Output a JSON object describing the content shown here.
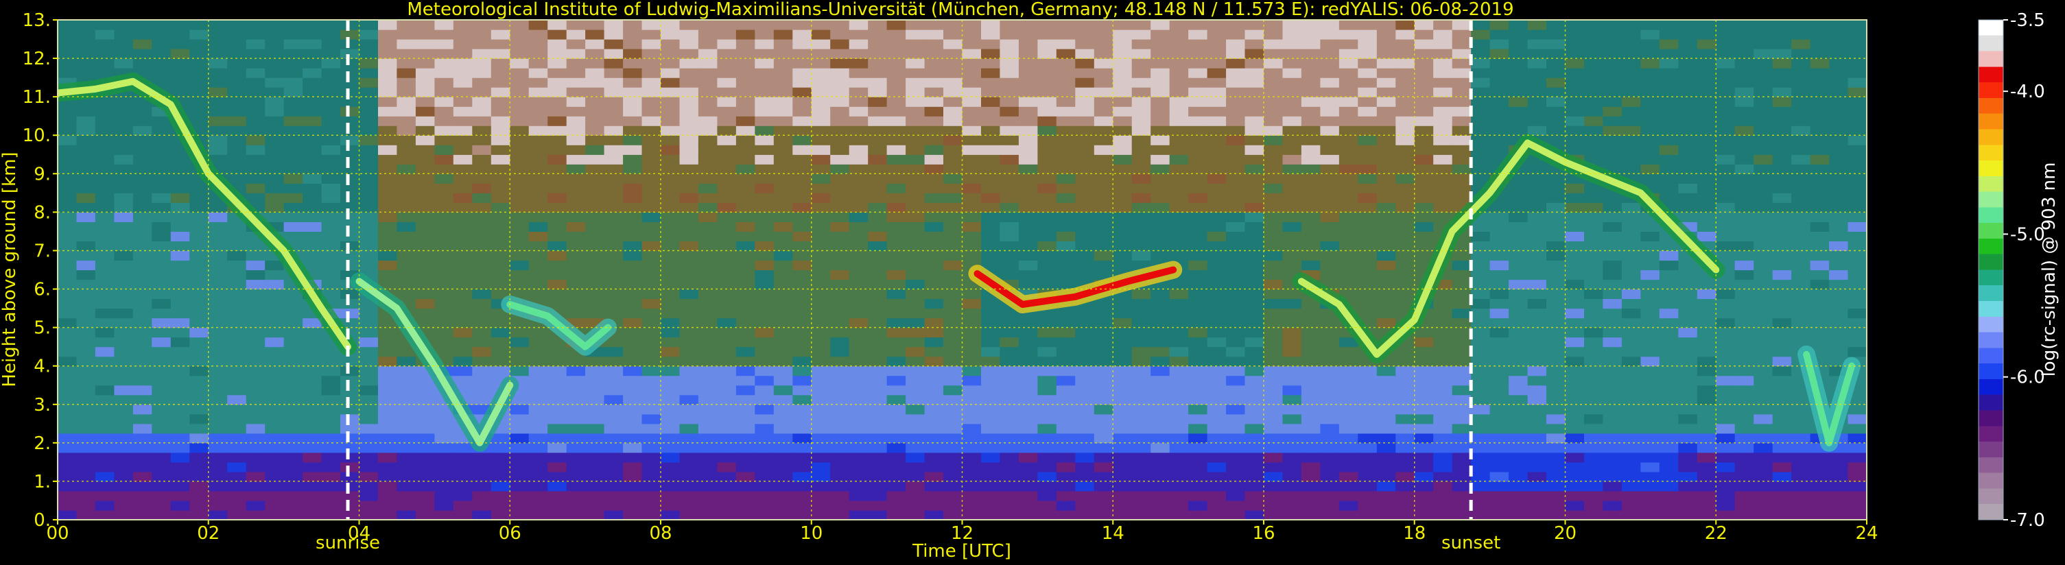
{
  "chart_data": {
    "type": "heatmap",
    "title": "Meteorological Institute of Ludwig-Maximilians-Universität (München, Germany; 48.148 N / 11.573 E):    redYALIS: 06-08-2019",
    "xlabel": "Time [UTC]",
    "ylabel": "Height above ground [km]",
    "xlim": [
      0,
      24
    ],
    "ylim": [
      0,
      13
    ],
    "x_ticks": [
      0,
      2,
      4,
      6,
      8,
      10,
      12,
      14,
      16,
      18,
      20,
      22,
      24
    ],
    "x_tick_labels": [
      "00",
      "02",
      "04",
      "06",
      "08",
      "10",
      "12",
      "14",
      "16",
      "18",
      "20",
      "22",
      "24"
    ],
    "y_ticks": [
      0,
      1,
      2,
      3,
      4,
      5,
      6,
      7,
      8,
      9,
      10,
      11,
      12,
      13
    ],
    "y_tick_labels": [
      "0.",
      "1.",
      "2.",
      "3.",
      "4.",
      "5.",
      "6.",
      "7.",
      "8.",
      "9.",
      "10.",
      "11.",
      "12.",
      "13."
    ],
    "grid": true,
    "events": [
      {
        "label": "sunrise",
        "x": 3.85
      },
      {
        "label": "sunset",
        "x": 18.75
      }
    ],
    "colorbar": {
      "label": "log(rc-signal) @ 903 nm",
      "range": [
        -7.0,
        -3.5
      ],
      "ticks": [
        -3.5,
        -4.0,
        -5.0,
        -6.0,
        -7.0
      ],
      "tick_labels": [
        "-3.5",
        "-4.0",
        "-5.0",
        "-6.0",
        "-7.0"
      ],
      "colors": [
        "#b0a4b0",
        "#a890a8",
        "#a07ca0",
        "#8e5e94",
        "#7a3e88",
        "#6a1e7e",
        "#52107a",
        "#2a14a0",
        "#0a1ed8",
        "#1e46f0",
        "#4664f8",
        "#6e86f8",
        "#98aef8",
        "#6ed8e0",
        "#3cc0b8",
        "#1ea880",
        "#189a3c",
        "#1ebe1e",
        "#56d856",
        "#5ee496",
        "#96ee96",
        "#c6f064",
        "#f0f01e",
        "#f8d418",
        "#f8b410",
        "#f88c0c",
        "#f8620a",
        "#f82a0a",
        "#e80a0a",
        "#f0bcbc",
        "#e0e0e0",
        "#ffffff"
      ]
    },
    "heatmap_cells": {
      "x_step_h": 0.25,
      "y_step_km": 0.25,
      "background_palette": [
        "#6a1e7e",
        "#3a22b0",
        "#1a3ce0",
        "#3a64f0",
        "#6a8ae8",
        "#2a8a86",
        "#1e7a74",
        "#4a7a4a",
        "#7a6a34",
        "#8a5a34",
        "#b08a7a",
        "#d8c8c8"
      ],
      "layers": [
        {
          "name": "",
          "points": [
            [
              0,
              0.3
            ],
            [
              4,
              0.3
            ],
            [
              8,
              0.3
            ],
            [
              12,
              0.3
            ],
            [
              16,
              0.3
            ],
            [
              20,
              0.3
            ],
            [
              24,
              0.3
            ]
          ]
        }
      ],
      "features": [
        {
          "x": [
            0.0,
            0.5,
            1.0,
            1.5,
            2.0,
            2.5,
            3.0,
            3.5,
            3.85
          ],
          "y": [
            11.1,
            11.2,
            11.4,
            10.8,
            9.0,
            8.0,
            7.0,
            5.5,
            4.5
          ],
          "intensity": -4.6
        },
        {
          "x": [
            4.0,
            4.5,
            5.0,
            5.3,
            5.6,
            6.0
          ],
          "y": [
            6.2,
            5.5,
            4.0,
            3.0,
            2.0,
            3.5
          ],
          "intensity": -4.7
        },
        {
          "x": [
            6.0,
            6.5,
            7.0,
            7.3
          ],
          "y": [
            5.6,
            5.3,
            4.5,
            5.0
          ],
          "intensity": -4.8
        },
        {
          "x": [
            12.2,
            12.8,
            13.5,
            14.2,
            14.8
          ],
          "y": [
            6.4,
            5.6,
            5.8,
            6.2,
            6.5
          ],
          "intensity": -3.8
        },
        {
          "x": [
            16.5,
            17.0,
            17.5,
            18.0,
            18.5,
            19.0,
            19.5,
            20.0,
            21.0,
            22.0
          ],
          "y": [
            6.2,
            5.6,
            4.3,
            5.2,
            7.5,
            8.5,
            9.8,
            9.3,
            8.5,
            6.5
          ],
          "intensity": -4.6
        },
        {
          "x": [
            23.2,
            23.5,
            23.8
          ],
          "y": [
            4.3,
            2.0,
            4.0
          ],
          "intensity": -4.8
        }
      ]
    }
  }
}
